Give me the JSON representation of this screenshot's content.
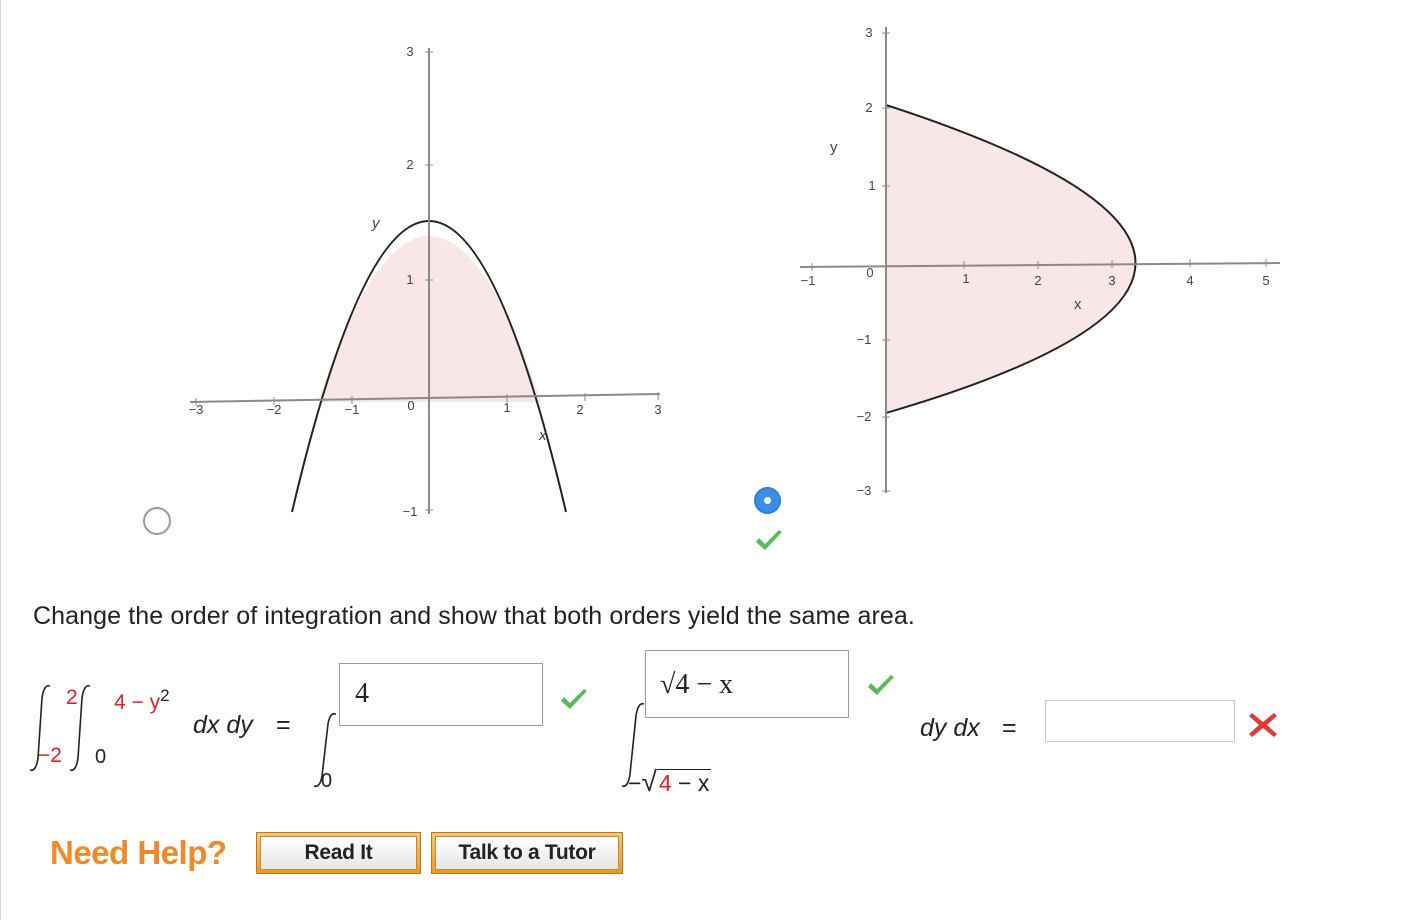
{
  "graph_left": {
    "x_ticks": [
      "−3",
      "−2",
      "−1",
      "0",
      "1",
      "2",
      "3"
    ],
    "y_ticks": [
      "3",
      "2",
      "1",
      "−1"
    ],
    "x_label": "x",
    "y_label": "y",
    "fill_color": "#f9e6e6",
    "curve_color": "#222222"
  },
  "graph_right": {
    "x_ticks": [
      "−1",
      "0",
      "1",
      "2",
      "3",
      "4",
      "5"
    ],
    "y_ticks": [
      "3",
      "2",
      "1",
      "−1",
      "−2",
      "−3"
    ],
    "x_label": "x",
    "y_label": "y",
    "fill_color": "#f9e6e6",
    "curve_color": "#222222"
  },
  "choices": {
    "left_selected": false,
    "right_selected": true,
    "right_correct_icon": "checkmark-icon"
  },
  "question_text": "Change the order of integration and show that both orders yield the same area.",
  "lhs": {
    "outer_upper": "2",
    "outer_lower": "−2",
    "inner_upper": "4 − y2",
    "inner_upper_base": "4 − y",
    "inner_upper_exp": "2",
    "inner_lower": "0",
    "differentials": "dx dy",
    "equals": "="
  },
  "rhs": {
    "outer_lower": "0",
    "outer_upper_answer": "4",
    "inner_upper_answer": "√4 − x",
    "inner_lower_sign": "−",
    "inner_lower_num": "4",
    "inner_lower_rest": "− x",
    "differentials": "dy dx",
    "equals": "=",
    "final_answer": ""
  },
  "status": {
    "outer_upper_icon": "checkmark-icon",
    "inner_upper_icon": "checkmark-icon",
    "final_icon": "x-icon",
    "check_color": "#5cb85c",
    "x_color": "#e03a3a"
  },
  "help": {
    "need_help": "Need Help?",
    "read_it": "Read It",
    "talk_to_tutor": "Talk to a Tutor"
  }
}
